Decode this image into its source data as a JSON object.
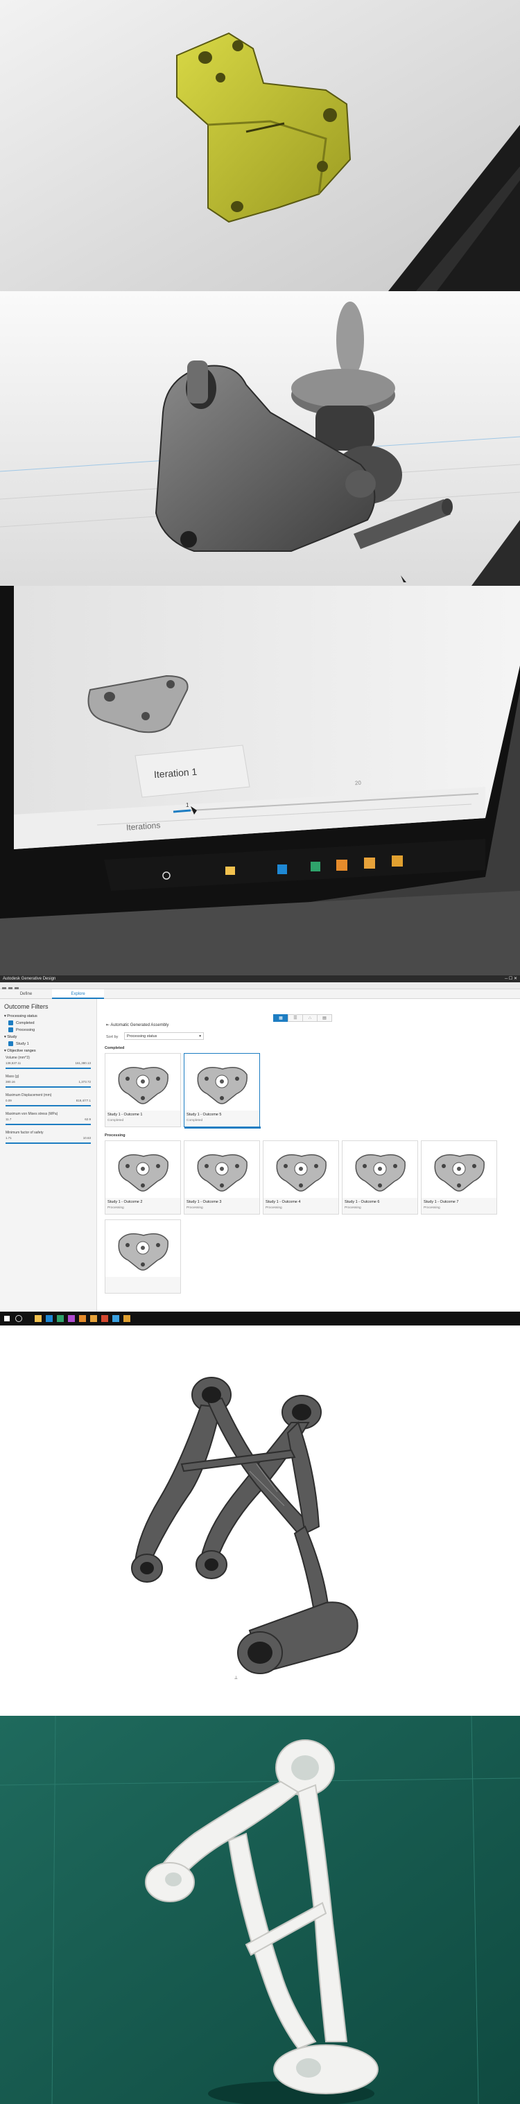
{
  "colors": {
    "accent": "#1d7dc2",
    "part_yellow": "#c9c934",
    "prototype_white": "#f2f2f0",
    "print_mat_green": "#17574d"
  },
  "photo3": {
    "iteration_label": "Iteration 1",
    "iterations_label": "Iterations",
    "slider_value": "1",
    "footer_counter": "20"
  },
  "app": {
    "title": "Autodesk Generative Design",
    "tabs": [
      "Define",
      "Explore"
    ],
    "active_tab": "Explore",
    "sidebar": {
      "title": "Outcome Filters",
      "processing_status_label": "Processing status",
      "status_options": [
        "Completed",
        "Processing"
      ],
      "study_label": "Study",
      "study_options": [
        "Study 1"
      ],
      "objective_ranges_label": "Objective ranges",
      "ranges": [
        {
          "label": "Volume (mm^3)",
          "min": "138,537.11",
          "max": "161,380.13"
        },
        {
          "label": "Mass (g)",
          "min": "380.16",
          "max": "1,373.72"
        },
        {
          "label": "Maximum Displacement (mm)",
          "min": "0.09",
          "max": "819,4/77.1"
        },
        {
          "label": "Maximum von Mises stress (MPa)",
          "min": "11.7",
          "max": "62.9"
        },
        {
          "label": "Minimum factor of safety",
          "min": "1.71",
          "max": "10.63"
        }
      ]
    },
    "main": {
      "study_title": "Automatic Generated Assembly",
      "sort_label": "Sort by",
      "sort_value": "Processing status",
      "view_icons": [
        "grid-icon",
        "list-icon",
        "scatter-icon",
        "table-icon"
      ],
      "groups": [
        {
          "label": "Completed",
          "cards": [
            {
              "name": "Study 1 - Outcome 1",
              "status": "Completed"
            },
            {
              "name": "Study 1 - Outcome 5",
              "status": "Completed"
            }
          ]
        },
        {
          "label": "Processing",
          "cards": [
            {
              "name": "Study 1 - Outcome 2",
              "status": "Processing"
            },
            {
              "name": "Study 1 - Outcome 3",
              "status": "Processing"
            },
            {
              "name": "Study 1 - Outcome 4",
              "status": "Processing"
            },
            {
              "name": "Study 1 - Outcome 6",
              "status": "Processing"
            },
            {
              "name": "Study 1 - Outcome 7",
              "status": "Processing"
            },
            {
              "name": "",
              "status": ""
            }
          ]
        }
      ]
    }
  }
}
